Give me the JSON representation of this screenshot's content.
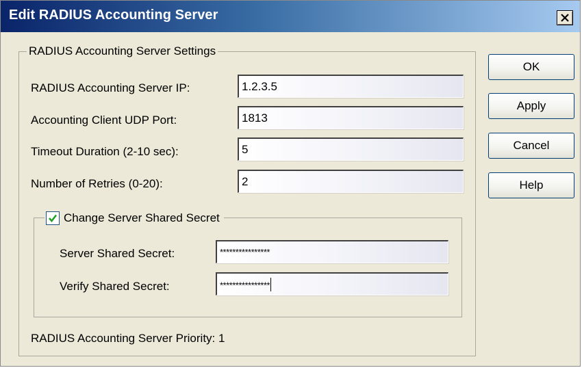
{
  "window": {
    "title": "Edit RADIUS Accounting Server",
    "close_symbol": "×"
  },
  "settings": {
    "group_title": "RADIUS Accounting Server Settings",
    "fields": [
      {
        "label": "RADIUS Accounting Server IP:",
        "value": "1.2.3.5"
      },
      {
        "label": "Accounting Client UDP Port:",
        "value": "1813"
      },
      {
        "label": "Timeout Duration (2-10 sec):",
        "value": "5"
      },
      {
        "label": "Number of Retries (0-20):",
        "value": "2"
      }
    ]
  },
  "shared_secret": {
    "checkbox_label": "Change Server Shared Secret",
    "checked": true,
    "server_secret_label": "Server Shared Secret:",
    "server_secret_value": "****************",
    "verify_secret_label": "Verify Shared Secret:",
    "verify_secret_value": "****************"
  },
  "priority_text": "RADIUS Accounting Server Priority: 1",
  "buttons": {
    "ok": "OK",
    "apply": "Apply",
    "cancel": "Cancel",
    "help": "Help"
  },
  "colors": {
    "titlebar_start": "#0a246a",
    "titlebar_end": "#a6caf0",
    "dialog_bg": "#ece9d8",
    "check_mark": "#21a121"
  }
}
